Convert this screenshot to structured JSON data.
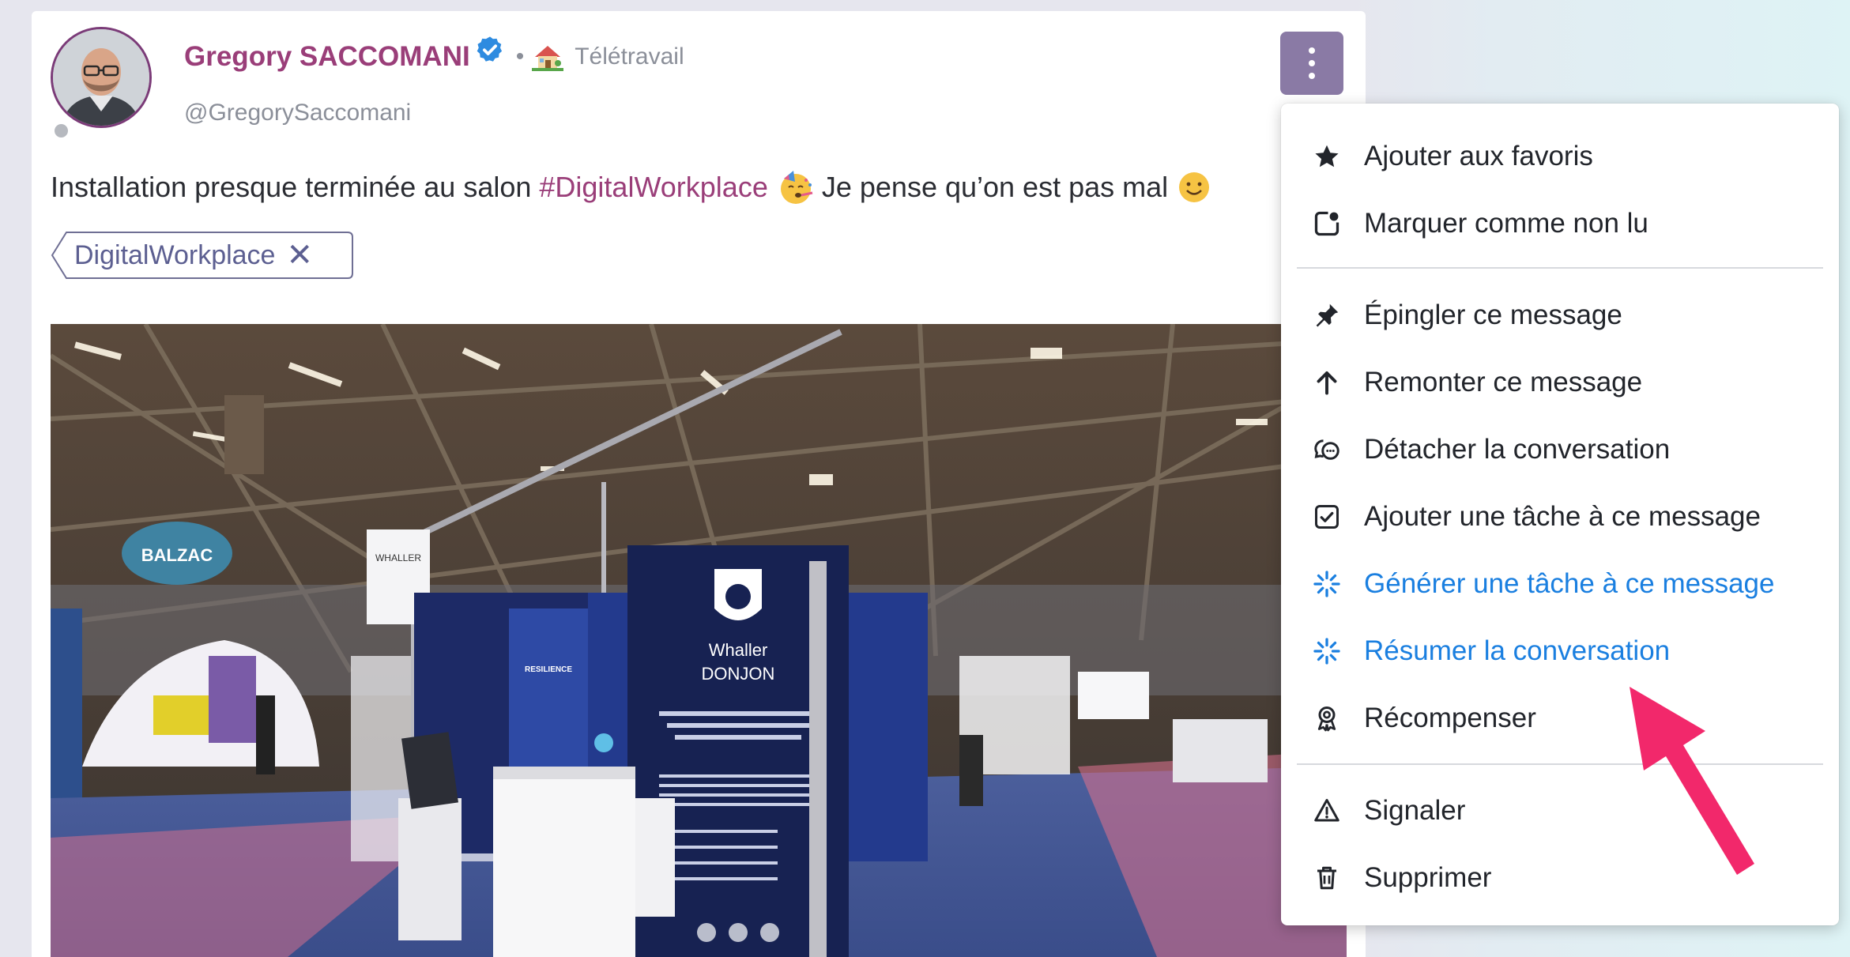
{
  "post": {
    "author_name": "Gregory SACCOMANI",
    "status_separator": "•",
    "status_text": "Télétravail",
    "handle": "@GregorySaccomani",
    "text_before": "Installation presque terminée au salon",
    "hashtag": "#DigitalWorkplace",
    "text_after": "Je pense qu’on est pas mal",
    "tag_chip": "DigitalWorkplace",
    "tag_remove": "✕"
  },
  "photo": {
    "signs": {
      "balzac": "BALZAC",
      "whaller": "Whaller",
      "donjon": "DONJON",
      "resilience": "RESILIENCE"
    }
  },
  "menu": {
    "items": [
      {
        "label": "Ajouter aux favoris",
        "icon": "star-icon"
      },
      {
        "label": "Marquer comme non lu",
        "icon": "unread-icon"
      },
      {
        "label": "Épingler ce message",
        "icon": "pin-icon"
      },
      {
        "label": "Remonter ce message",
        "icon": "arrow-up-icon"
      },
      {
        "label": "Détacher la conversation",
        "icon": "detach-conversation-icon"
      },
      {
        "label": "Ajouter une tâche à ce message",
        "icon": "checkbox-icon"
      },
      {
        "label": "Générer une tâche à ce message",
        "icon": "sparkle-icon"
      },
      {
        "label": "Résumer la conversation",
        "icon": "sparkle-icon"
      },
      {
        "label": "Récompenser",
        "icon": "award-icon"
      },
      {
        "label": "Signaler",
        "icon": "warning-icon"
      },
      {
        "label": "Supprimer",
        "icon": "trash-icon"
      }
    ]
  },
  "colors": {
    "author": "#9a3e79",
    "hashtag": "#9a3e79",
    "ai_action": "#1a7fe0",
    "more_button": "#8a7aa5",
    "annotation_arrow": "#f2286b"
  }
}
